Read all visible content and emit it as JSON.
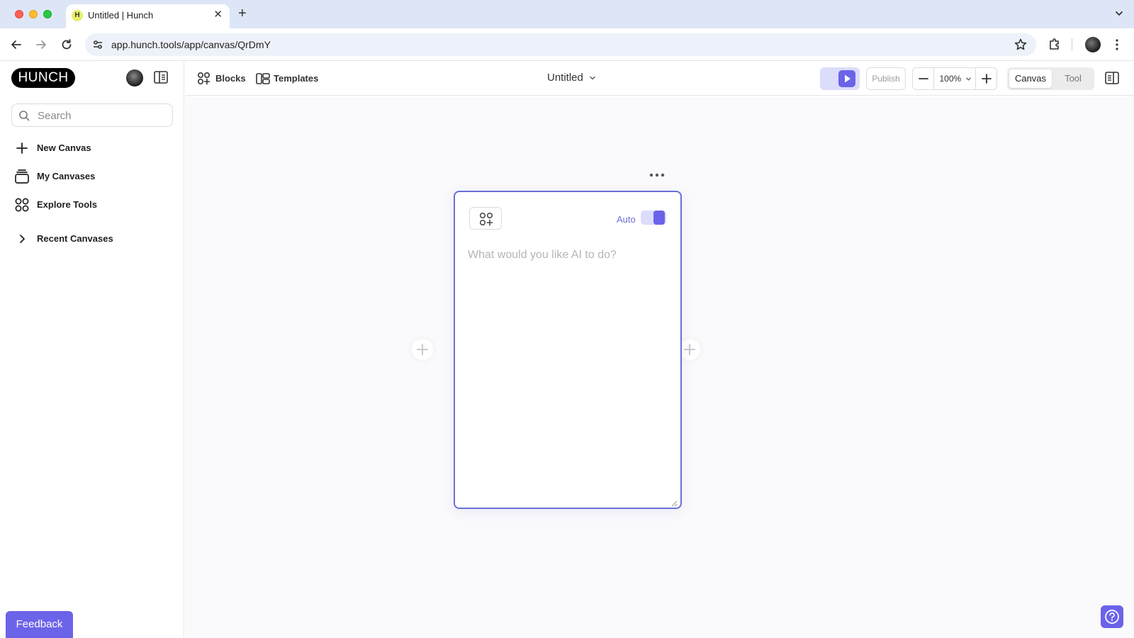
{
  "browser": {
    "tab_title": "Untitled | Hunch",
    "tab_favicon_letter": "H",
    "url": "app.hunch.tools/app/canvas/QrDmY"
  },
  "sidebar": {
    "logo_text": "HUNCH",
    "search_placeholder": "Search",
    "items": [
      {
        "label": "New Canvas",
        "icon": "plus-icon"
      },
      {
        "label": "My Canvases",
        "icon": "stack-icon"
      },
      {
        "label": "Explore Tools",
        "icon": "grid-icon"
      },
      {
        "label": "Recent Canvases",
        "icon": "chevron-right-icon"
      }
    ],
    "feedback_label": "Feedback"
  },
  "header": {
    "blocks_label": "Blocks",
    "templates_label": "Templates",
    "doc_title": "Untitled",
    "publish_label": "Publish",
    "zoom_level": "100%",
    "mode_options": [
      "Canvas",
      "Tool"
    ],
    "active_mode": "Canvas"
  },
  "canvas": {
    "block": {
      "auto_label": "Auto",
      "auto_enabled": true,
      "prompt_placeholder": "What would you like AI to do?",
      "prompt_value": ""
    }
  },
  "colors": {
    "accent": "#6b63e8",
    "accent_light": "#dcdcfb",
    "card_border": "#6b6fd4",
    "tab_strip": "#dde6f7"
  }
}
